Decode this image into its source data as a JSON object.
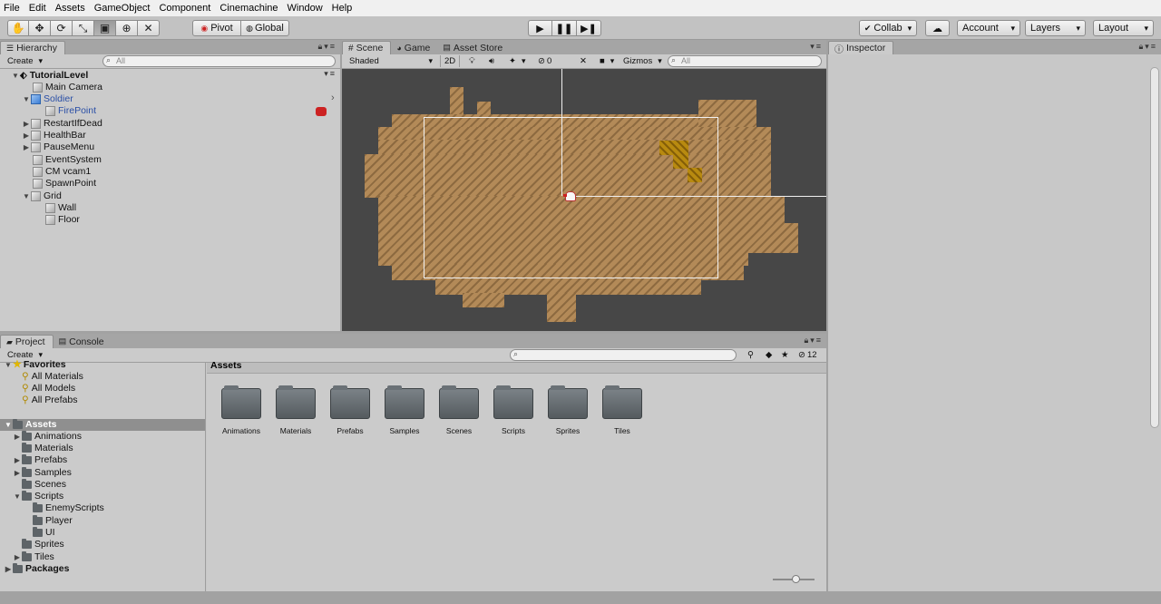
{
  "menu": [
    "File",
    "Edit",
    "Assets",
    "GameObject",
    "Component",
    "Cinemachine",
    "Window",
    "Help"
  ],
  "toolbar": {
    "tools": [
      "hand-tool",
      "move-tool",
      "rotate-tool",
      "scale-tool",
      "rect-tool",
      "transform-tool",
      "custom-tool"
    ],
    "pivot": "Pivot",
    "global": "Global",
    "collab": "Collab",
    "account": "Account",
    "layers": "Layers",
    "layout": "Layout"
  },
  "hierarchy": {
    "tab": "Hierarchy",
    "create": "Create",
    "search_placeholder": "All",
    "scene_name": "TutorialLevel",
    "items": [
      "Main Camera",
      "Soldier",
      "FirePoint",
      "RestartIfDead",
      "HealthBar",
      "PauseMenu",
      "EventSystem",
      "CM vcam1",
      "SpawnPoint",
      "Grid",
      "Wall",
      "Floor"
    ]
  },
  "scene": {
    "tabs": [
      "Scene",
      "Game",
      "Asset Store"
    ],
    "shading": "Shaded",
    "mode_2d": "2D",
    "fx_count": "0",
    "gizmos": "Gizmos",
    "search_placeholder": "All"
  },
  "inspector": {
    "tab": "Inspector"
  },
  "project": {
    "tabs": [
      "Project",
      "Console"
    ],
    "create": "Create",
    "hidden_count": "12",
    "favorites": {
      "label": "Favorites",
      "items": [
        "All Materials",
        "All Models",
        "All Prefabs"
      ]
    },
    "assets_label": "Assets",
    "tree": [
      "Animations",
      "Materials",
      "Prefabs",
      "Samples",
      "Scenes",
      "Scripts",
      "EnemyScripts",
      "Player",
      "UI",
      "Sprites",
      "Tiles"
    ],
    "packages_label": "Packages",
    "breadcrumb": "Assets",
    "folders": [
      "Animations",
      "Materials",
      "Prefabs",
      "Samples",
      "Scenes",
      "Scripts",
      "Sprites",
      "Tiles"
    ]
  },
  "colors": {
    "floor": "#b38a58",
    "scene_bg": "#474747",
    "selected_text": "#2a4fa6",
    "panel_bg": "#c8c8c8"
  }
}
